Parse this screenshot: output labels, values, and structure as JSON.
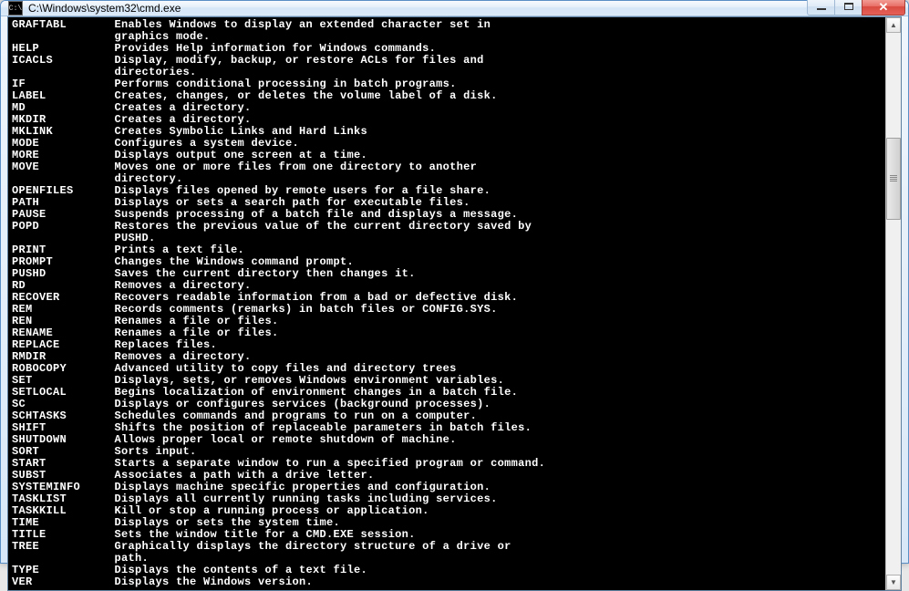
{
  "window": {
    "title": "C:\\Windows\\system32\\cmd.exe",
    "icon_label": "C:\\"
  },
  "controls": {
    "minimize": "−",
    "maximize": "☐",
    "close": "✕"
  },
  "scrollbar": {
    "up": "▲",
    "down": "▼"
  },
  "entries": [
    {
      "cmd": "GRAFTABL",
      "desc": [
        "Enables Windows to display an extended character set in",
        "graphics mode."
      ]
    },
    {
      "cmd": "HELP",
      "desc": [
        "Provides Help information for Windows commands."
      ]
    },
    {
      "cmd": "ICACLS",
      "desc": [
        "Display, modify, backup, or restore ACLs for files and",
        "directories."
      ]
    },
    {
      "cmd": "IF",
      "desc": [
        "Performs conditional processing in batch programs."
      ]
    },
    {
      "cmd": "LABEL",
      "desc": [
        "Creates, changes, or deletes the volume label of a disk."
      ]
    },
    {
      "cmd": "MD",
      "desc": [
        "Creates a directory."
      ]
    },
    {
      "cmd": "MKDIR",
      "desc": [
        "Creates a directory."
      ]
    },
    {
      "cmd": "MKLINK",
      "desc": [
        "Creates Symbolic Links and Hard Links"
      ]
    },
    {
      "cmd": "MODE",
      "desc": [
        "Configures a system device."
      ]
    },
    {
      "cmd": "MORE",
      "desc": [
        "Displays output one screen at a time."
      ]
    },
    {
      "cmd": "MOVE",
      "desc": [
        "Moves one or more files from one directory to another",
        "directory."
      ]
    },
    {
      "cmd": "OPENFILES",
      "desc": [
        "Displays files opened by remote users for a file share."
      ]
    },
    {
      "cmd": "PATH",
      "desc": [
        "Displays or sets a search path for executable files."
      ]
    },
    {
      "cmd": "PAUSE",
      "desc": [
        "Suspends processing of a batch file and displays a message."
      ]
    },
    {
      "cmd": "POPD",
      "desc": [
        "Restores the previous value of the current directory saved by",
        "PUSHD."
      ]
    },
    {
      "cmd": "PRINT",
      "desc": [
        "Prints a text file."
      ]
    },
    {
      "cmd": "PROMPT",
      "desc": [
        "Changes the Windows command prompt."
      ]
    },
    {
      "cmd": "PUSHD",
      "desc": [
        "Saves the current directory then changes it."
      ]
    },
    {
      "cmd": "RD",
      "desc": [
        "Removes a directory."
      ]
    },
    {
      "cmd": "RECOVER",
      "desc": [
        "Recovers readable information from a bad or defective disk."
      ]
    },
    {
      "cmd": "REM",
      "desc": [
        "Records comments (remarks) in batch files or CONFIG.SYS."
      ]
    },
    {
      "cmd": "REN",
      "desc": [
        "Renames a file or files."
      ]
    },
    {
      "cmd": "RENAME",
      "desc": [
        "Renames a file or files."
      ]
    },
    {
      "cmd": "REPLACE",
      "desc": [
        "Replaces files."
      ]
    },
    {
      "cmd": "RMDIR",
      "desc": [
        "Removes a directory."
      ]
    },
    {
      "cmd": "ROBOCOPY",
      "desc": [
        "Advanced utility to copy files and directory trees"
      ]
    },
    {
      "cmd": "SET",
      "desc": [
        "Displays, sets, or removes Windows environment variables."
      ]
    },
    {
      "cmd": "SETLOCAL",
      "desc": [
        "Begins localization of environment changes in a batch file."
      ]
    },
    {
      "cmd": "SC",
      "desc": [
        "Displays or configures services (background processes)."
      ]
    },
    {
      "cmd": "SCHTASKS",
      "desc": [
        "Schedules commands and programs to run on a computer."
      ]
    },
    {
      "cmd": "SHIFT",
      "desc": [
        "Shifts the position of replaceable parameters in batch files."
      ]
    },
    {
      "cmd": "SHUTDOWN",
      "desc": [
        "Allows proper local or remote shutdown of machine."
      ]
    },
    {
      "cmd": "SORT",
      "desc": [
        "Sorts input."
      ]
    },
    {
      "cmd": "START",
      "desc": [
        "Starts a separate window to run a specified program or command."
      ]
    },
    {
      "cmd": "SUBST",
      "desc": [
        "Associates a path with a drive letter."
      ]
    },
    {
      "cmd": "SYSTEMINFO",
      "desc": [
        "Displays machine specific properties and configuration."
      ]
    },
    {
      "cmd": "TASKLIST",
      "desc": [
        "Displays all currently running tasks including services."
      ]
    },
    {
      "cmd": "TASKKILL",
      "desc": [
        "Kill or stop a running process or application."
      ]
    },
    {
      "cmd": "TIME",
      "desc": [
        "Displays or sets the system time."
      ]
    },
    {
      "cmd": "TITLE",
      "desc": [
        "Sets the window title for a CMD.EXE session."
      ]
    },
    {
      "cmd": "TREE",
      "desc": [
        "Graphically displays the directory structure of a drive or",
        "path."
      ]
    },
    {
      "cmd": "TYPE",
      "desc": [
        "Displays the contents of a text file."
      ]
    },
    {
      "cmd": "VER",
      "desc": [
        "Displays the Windows version."
      ]
    }
  ]
}
